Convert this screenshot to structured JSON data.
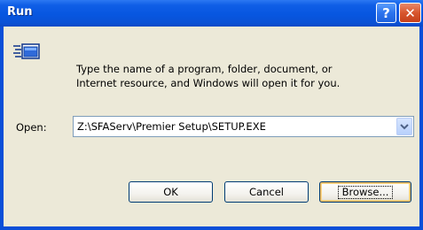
{
  "window": {
    "title": "Run",
    "help_button_label": "?",
    "close_button_label": "✕"
  },
  "icon": "run-dialog-icon",
  "description": {
    "line1": "Type the name of a program, folder, document, or",
    "line2": "Internet resource, and Windows will open it for you."
  },
  "open_field": {
    "label": "Open:",
    "value": "Z:\\SFAServ\\Premier Setup\\SETUP.EXE"
  },
  "buttons": {
    "ok": "OK",
    "cancel": "Cancel",
    "browse": "Browse..."
  },
  "colors": {
    "titlebar": "#0a52d6",
    "frame": "#0a4fd8",
    "client": "#ece9d8",
    "close": "#d8562e"
  }
}
